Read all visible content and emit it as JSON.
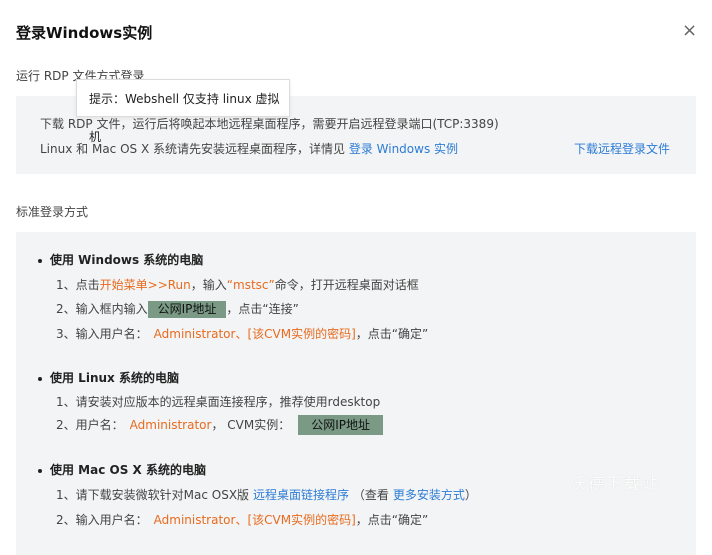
{
  "dialog": {
    "title": "登录Windows实例",
    "close": "×"
  },
  "rdp": {
    "section_title": "运行 RDP 文件方式登录",
    "line1": "下载 RDP 文件，运行后将唤起本地远程桌面程序，需要开启远程登录端口(TCP:3389)",
    "line2_prefix": "Linux 和 Mac OS X 系统请先安装远程桌面程序，详情见",
    "line2_link": "登录 Windows 实例",
    "download_link": "下载远程登录文件"
  },
  "tooltip": "提示：Webshell 仅支持 linux 虚拟机",
  "standard": {
    "section_title": "标准登录方式",
    "windows": {
      "heading": "使用 Windows 系统的电脑",
      "s1_prefix": "1、点击",
      "s1_menu": "开始菜单>>Run",
      "s1_mid": "，输入",
      "s1_cmd": "“mstsc”",
      "s1_suffix": "命令，打开远程桌面对话框",
      "s2_prefix": "2、输入框内输入",
      "s2_ip": "公网IP地址",
      "s2_suffix": "，点击“连接”",
      "s3_prefix": "3、输入用户名：",
      "s3_user": "Administrator、[该CVM实例的密码]",
      "s3_suffix": "，点击“确定”"
    },
    "linux": {
      "heading": "使用 Linux 系统的电脑",
      "s1": "1、请安装对应版本的远程桌面连接程序，推荐使用rdesktop",
      "s2_prefix": "2、用户名：",
      "s2_user": "Administrator",
      "s2_mid": "，  CVM实例：",
      "s2_ip": "公网IP地址"
    },
    "mac": {
      "heading": "使用 Mac OS X 系统的电脑",
      "s1_prefix": "1、请下载安装微软针对Mac OSX版",
      "s1_link": "远程桌面链接程序",
      "s1_mid": " （查看",
      "s1_link2": "更多安装方式",
      "s1_suffix": "）",
      "s2_prefix": "2、输入用户名：",
      "s2_user": "Administrator、[该CVM实例的密码]",
      "s2_suffix": "，点击“确定”"
    }
  },
  "watermark": "沃德下载站"
}
